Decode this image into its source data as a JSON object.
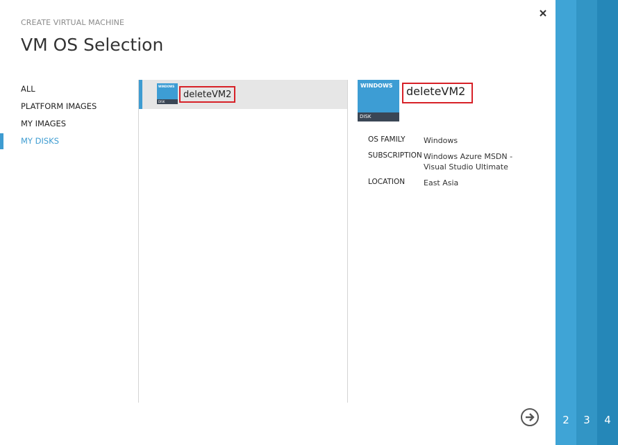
{
  "header": {
    "supertitle": "CREATE VIRTUAL MACHINE",
    "title": "VM OS Selection",
    "close_icon": "close-icon"
  },
  "nav": {
    "items": [
      {
        "label": "ALL"
      },
      {
        "label": "PLATFORM IMAGES"
      },
      {
        "label": "MY IMAGES"
      },
      {
        "label": "MY DISKS",
        "active": true
      }
    ]
  },
  "list": {
    "items": [
      {
        "name": "deleteVM2",
        "tile_top": "WINDOWS",
        "tile_bottom": "DISK",
        "selected": true
      }
    ]
  },
  "detail": {
    "name": "deleteVM2",
    "tile_top": "WINDOWS",
    "tile_bottom": "DISK",
    "props": [
      {
        "label": "OS FAMILY",
        "value": "Windows"
      },
      {
        "label": "SUBSCRIPTION",
        "value": "Windows Azure MSDN - Visual Studio Ultimate"
      },
      {
        "label": "LOCATION",
        "value": "East Asia"
      }
    ]
  },
  "footer": {
    "next_icon": "arrow-right-circle-icon"
  },
  "steps": [
    "2",
    "3",
    "4"
  ],
  "colors": {
    "accent": "#3e9cd1",
    "highlight_border": "#d72027",
    "strip_1": "#3fa4d6",
    "strip_2": "#3295c5",
    "strip_3": "#2587b8",
    "tile": "#3d9dd4",
    "tile_bar": "#3a4655"
  }
}
